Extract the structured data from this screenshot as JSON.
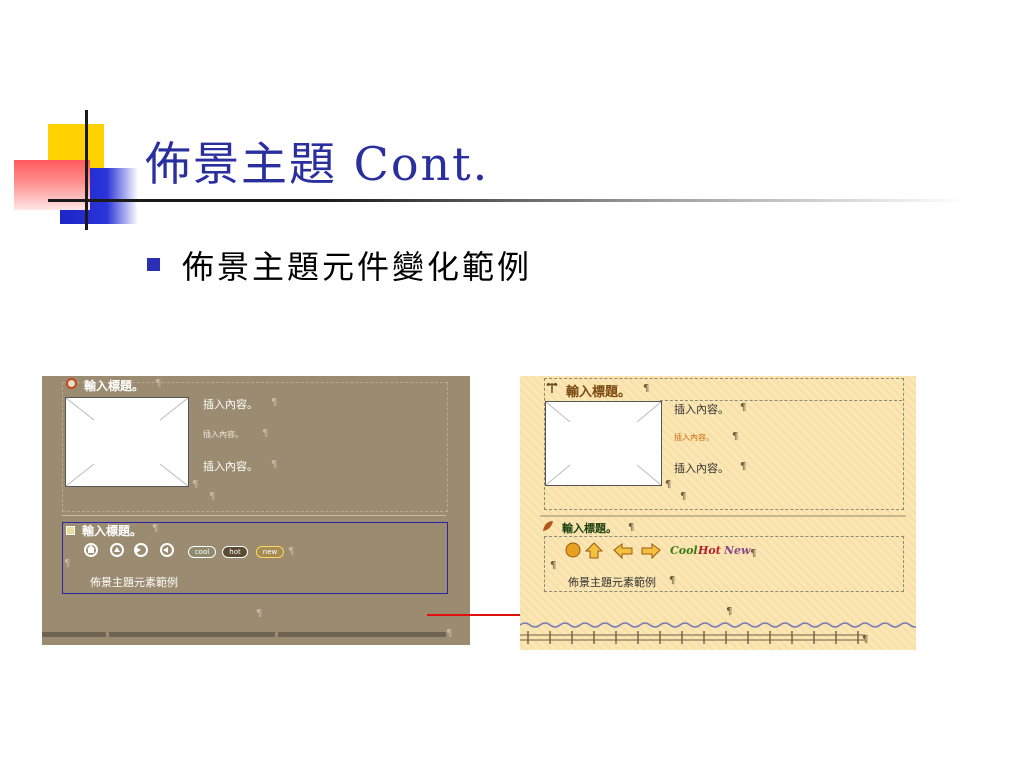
{
  "slide": {
    "title": "佈景主題 Cont.",
    "bullet": "佈景主題元件變化範例"
  },
  "left_shot": {
    "heading1": "輸入標題。",
    "content1": "插入內容。",
    "content2": "插入內容。",
    "content3": "插入內容。",
    "heading2": "輸入標題。",
    "pill_cool": "cool",
    "pill_hot": "hot",
    "pill_new": "new",
    "caption": "佈景主題元素範例",
    "pilcrow": "¶"
  },
  "right_shot": {
    "heading1": "輸入標題。",
    "content1": "插入內容。",
    "content2": "插入內容。",
    "content3": "插入內容。",
    "heading2": "輸入標題。",
    "word_cool": "Cool",
    "word_hot": "Hot",
    "word_new": "New",
    "caption": "佈景主題元素範例",
    "pilcrow": "¶"
  },
  "colors": {
    "title": "#2a2f9e",
    "arrow": "#e01010",
    "left_bg": "#9b8b70",
    "right_bg": "#fbe7b6"
  }
}
